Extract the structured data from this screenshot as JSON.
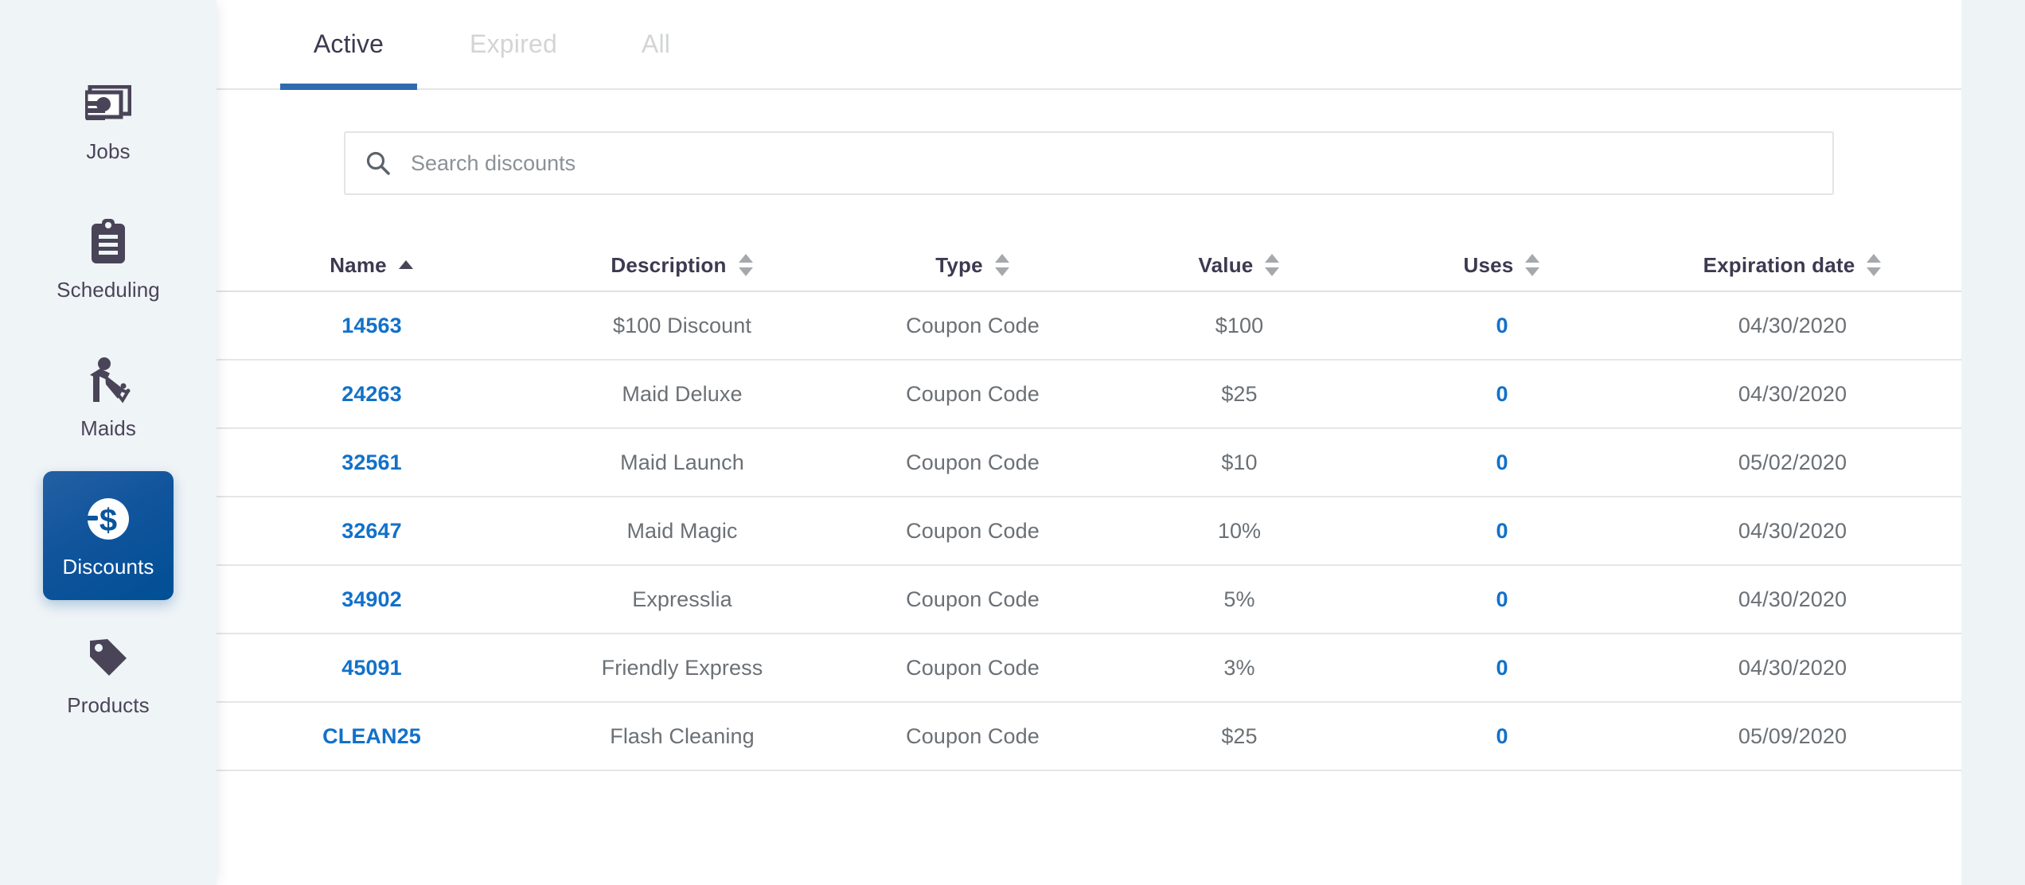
{
  "colors": {
    "accent": "#004f95",
    "link": "#1271c9",
    "tab_underline": "#2f6bae",
    "sidebar_bg": "#eff4f7",
    "text_dark": "#3d3950",
    "text_muted": "#6b7075",
    "tab_inactive": "#d3d4d6"
  },
  "sidebar": {
    "items": [
      {
        "label": "Jobs",
        "icon": "money-icon",
        "active": false
      },
      {
        "label": "Scheduling",
        "icon": "clipboard-icon",
        "active": false
      },
      {
        "label": "Maids",
        "icon": "maid-icon",
        "active": false
      },
      {
        "label": "Discounts",
        "icon": "dollar-circle-icon",
        "active": true
      },
      {
        "label": "Products",
        "icon": "tag-icon",
        "active": false
      }
    ]
  },
  "tabs": [
    {
      "label": "Active",
      "selected": true
    },
    {
      "label": "Expired",
      "selected": false
    },
    {
      "label": "All",
      "selected": false
    }
  ],
  "search": {
    "placeholder": "Search discounts",
    "value": "",
    "icon": "search-icon"
  },
  "table": {
    "columns": [
      {
        "label": "Name",
        "sort": "asc",
        "key": "name"
      },
      {
        "label": "Description",
        "sort": "none",
        "key": "description"
      },
      {
        "label": "Type",
        "sort": "none",
        "key": "type"
      },
      {
        "label": "Value",
        "sort": "none",
        "key": "value"
      },
      {
        "label": "Uses",
        "sort": "none",
        "key": "uses"
      },
      {
        "label": "Expiration date",
        "sort": "none",
        "key": "expiration"
      }
    ],
    "rows": [
      {
        "name": "14563",
        "description": "$100 Discount",
        "type": "Coupon Code",
        "value": "$100",
        "uses": "0",
        "expiration": "04/30/2020"
      },
      {
        "name": "24263",
        "description": "Maid Deluxe",
        "type": "Coupon Code",
        "value": "$25",
        "uses": "0",
        "expiration": "04/30/2020"
      },
      {
        "name": "32561",
        "description": "Maid Launch",
        "type": "Coupon Code",
        "value": "$10",
        "uses": "0",
        "expiration": "05/02/2020"
      },
      {
        "name": "32647",
        "description": "Maid Magic",
        "type": "Coupon Code",
        "value": "10%",
        "uses": "0",
        "expiration": "04/30/2020"
      },
      {
        "name": "34902",
        "description": "Expresslia",
        "type": "Coupon Code",
        "value": "5%",
        "uses": "0",
        "expiration": "04/30/2020"
      },
      {
        "name": "45091",
        "description": "Friendly Express",
        "type": "Coupon Code",
        "value": "3%",
        "uses": "0",
        "expiration": "04/30/2020"
      },
      {
        "name": "CLEAN25",
        "description": "Flash Cleaning",
        "type": "Coupon Code",
        "value": "$25",
        "uses": "0",
        "expiration": "05/09/2020"
      }
    ]
  }
}
